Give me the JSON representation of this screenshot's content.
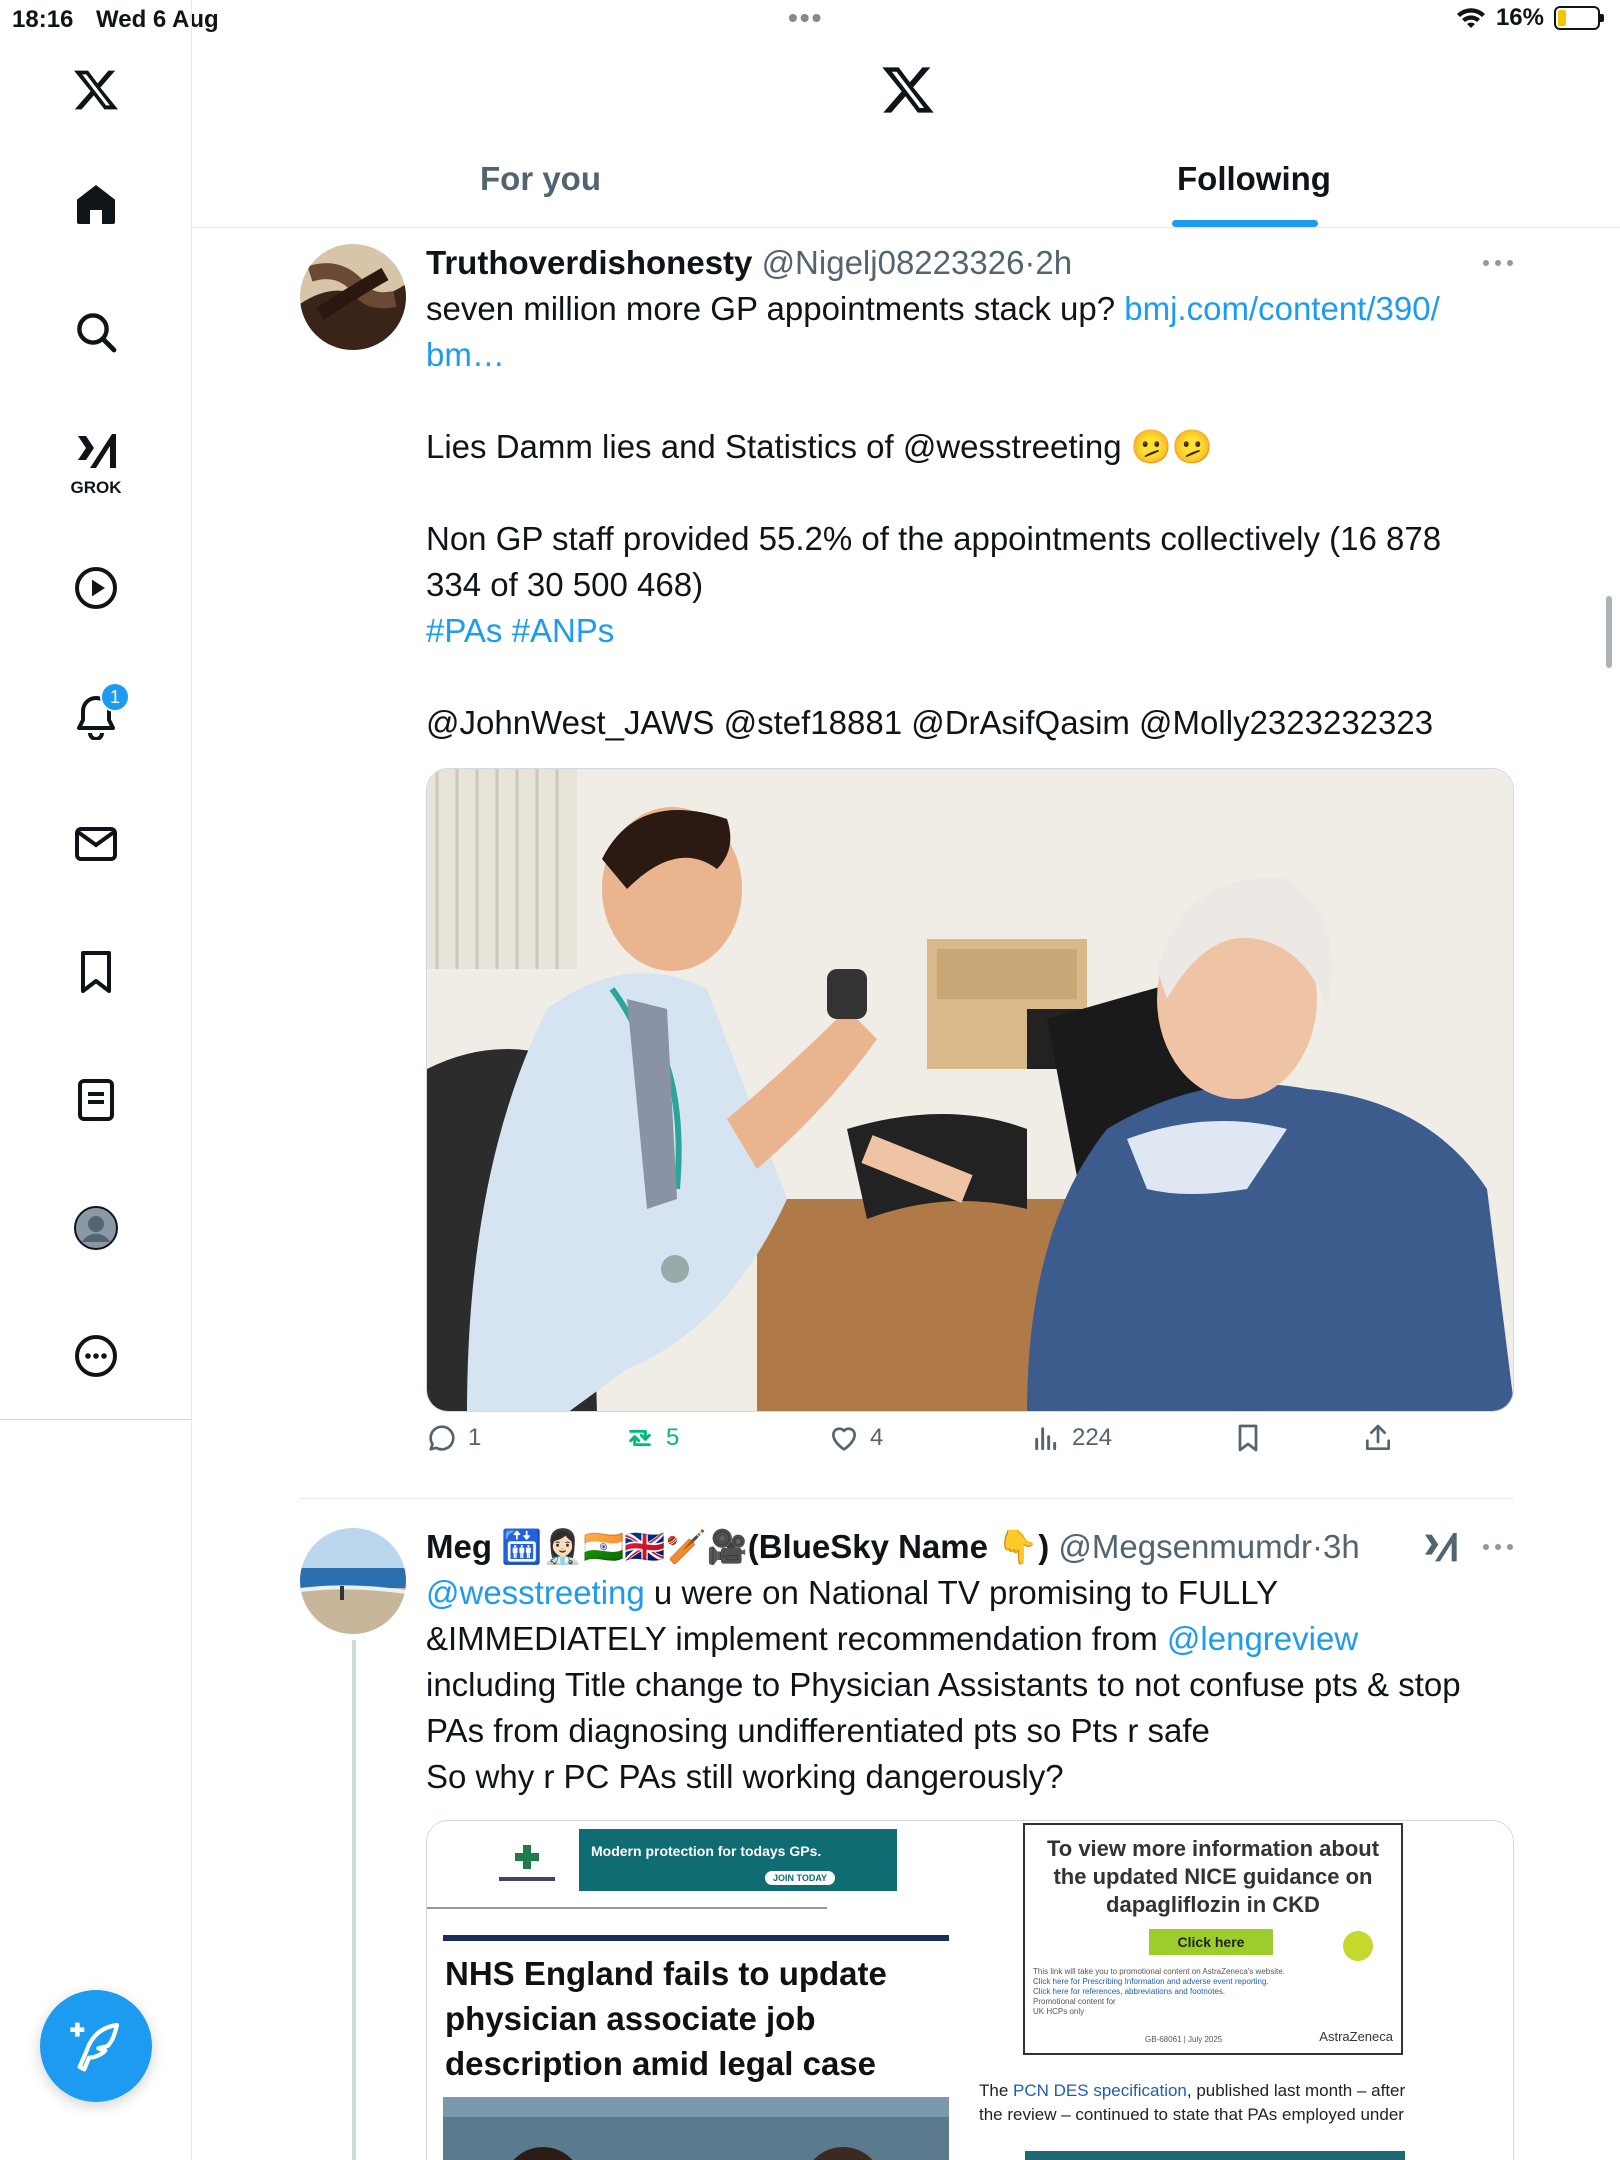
{
  "status_bar": {
    "time": "18:16",
    "date": "Wed 6 Aug",
    "battery": "16%"
  },
  "sidebar": {
    "grok_label": "GROK",
    "notifications_badge": "1",
    "icons": [
      "x-logo-icon",
      "home-icon",
      "search-icon",
      "grok-icon",
      "video-icon",
      "notifications-icon",
      "messages-icon",
      "bookmarks-icon",
      "lists-icon",
      "profile-icon",
      "more-icon"
    ]
  },
  "header": {
    "tabs": [
      {
        "label": "For you"
      },
      {
        "label": "Following"
      }
    ],
    "active_tab": "Following"
  },
  "tweets": [
    {
      "display_name": "Truthoverdishonesty",
      "handle": "@Nigelj08223326",
      "sep": "·",
      "time": "2h",
      "text_line1": "seven million more GP appointments stack up? ",
      "link1": "bmj.com/content/390/",
      "link1b": "bm…",
      "text_line2": "Lies Damm lies and Statistics of @wesstreeting 🫤🫤",
      "text_line3a": "Non GP staff provided 55.2% of the appointments collectively (16 878",
      "text_line3b": "334 of 30 500 468)",
      "hashtags": "#PAs #ANPs",
      "mentions": "@JohnWest_JAWS @stef18881 @DrAsifQasim @Molly2323232323",
      "image_desc": "doctor-with-patient-photo",
      "replies": "1",
      "retweets": "5",
      "likes": "4",
      "views": "224"
    },
    {
      "display_name": "Meg 🛗👩🏻‍⚕️🇮🇳🇬🇧🏏🎥(BlueSky Name 👇)",
      "handle": "@Megsenmumdr",
      "sep": "·",
      "time": "3h",
      "mention1": "@wesstreeting",
      "text1": " u were on National TV promising to FULLY",
      "text2": "&IMMEDIATELY implement recommendation from ",
      "mention2": "@lengreview",
      "text3": "including Title change to Physician Assistants to not confuse pts & stop",
      "text4": "PAs from diagnosing undifferentiated pts so Pts r safe",
      "text5": "So why r PC PAs still working dangerously?",
      "article": {
        "banner_text": "Modern protection for todays GPs.",
        "banner_button": "JOIN TODAY",
        "headline": "NHS England fails to update physician associate job description amid legal case",
        "ad_text": "To view more information about the updated NICE guidance on dapagliflozin in CKD",
        "ad_button": "Click here",
        "ad_small1": "This link will take you to promotional content on AstraZeneca's website.",
        "ad_small2": "Click here for Prescribing Information and adverse event reporting.",
        "ad_small3": "Click here for references, abbreviations and footnotes.",
        "ad_small4": "Promotional content for UK HCPs only",
        "ad_code": "GB-68061 | July 2025",
        "ad_brand": "AstraZeneca",
        "body_prefix": "The ",
        "body_link": "PCN DES specification",
        "body_suffix": ", published last month – after",
        "body_line2": "the review – continued to state that PAs employed under"
      }
    }
  ],
  "colors": {
    "accent": "#1d9bf0",
    "retweet": "#00ba7c",
    "secondary_text": "#536471"
  }
}
